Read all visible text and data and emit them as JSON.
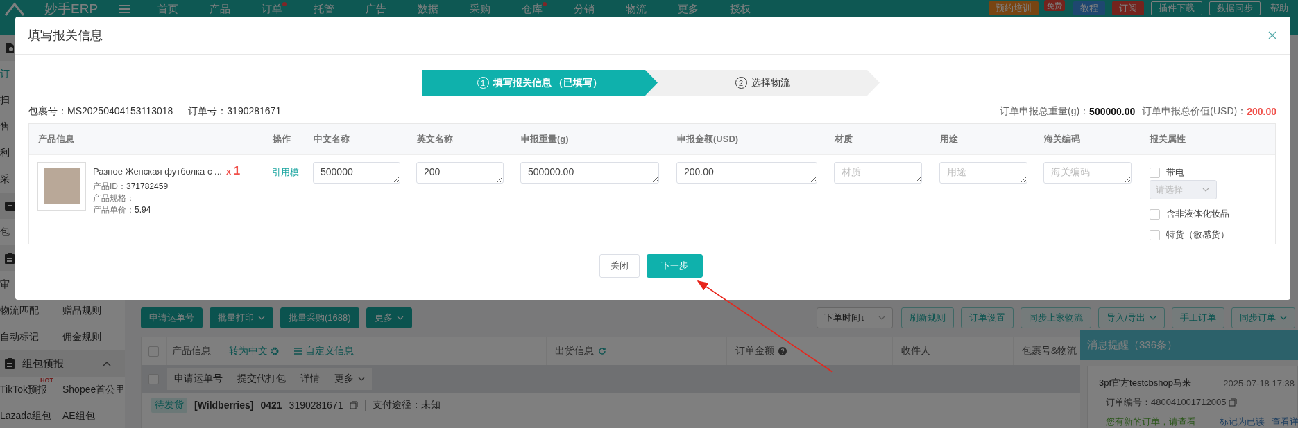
{
  "top_nav": {
    "logo": "妙手ERP",
    "items": [
      {
        "label": "首页",
        "dot": false
      },
      {
        "label": "产品",
        "dot": false
      },
      {
        "label": "订单",
        "dot": true
      },
      {
        "label": "托管",
        "dot": false
      },
      {
        "label": "广告",
        "dot": false
      },
      {
        "label": "数据",
        "dot": false
      },
      {
        "label": "采购",
        "dot": false
      },
      {
        "label": "仓库",
        "dot": true
      },
      {
        "label": "分销",
        "dot": false
      },
      {
        "label": "物流",
        "dot": false
      },
      {
        "label": "更多",
        "dot": false
      },
      {
        "label": "授权",
        "dot": false
      }
    ],
    "actions": [
      {
        "kind": "promo",
        "label": "预约培训",
        "badge": "免费"
      },
      {
        "kind": "info",
        "label": "教程"
      },
      {
        "kind": "danger",
        "label": "订阅"
      },
      {
        "kind": "outline",
        "label": "插件下载"
      },
      {
        "kind": "sync",
        "label": "数据同步"
      },
      {
        "kind": "help",
        "label": "帮助"
      }
    ]
  },
  "sidebar": {
    "sections": [
      {
        "kind": "gear-doc",
        "rows": [
          [
            {
              "label": "订",
              "selected": true
            }
          ],
          [
            {
              "label": "扫",
              "selected": false
            }
          ],
          [
            {
              "label": "售",
              "selected": false
            }
          ],
          [
            {
              "label": "利",
              "selected": false
            }
          ],
          [
            {
              "label": "采",
              "selected": false
            }
          ]
        ]
      },
      {
        "kind": "box",
        "rows": [
          [
            {
              "label": "包",
              "selected": false
            }
          ]
        ]
      },
      {
        "kind": "clipboard",
        "rows": [
          [
            {
              "label": "审",
              "selected": false
            }
          ],
          [
            {
              "label": "物流匹配",
              "selected": false
            },
            {
              "label": "赠品规则",
              "selected": false
            }
          ],
          [
            {
              "label": "自动标记",
              "selected": false
            },
            {
              "label": "佣金规则",
              "selected": false
            }
          ]
        ]
      },
      {
        "kind": "clipboard",
        "title": "组包预报",
        "expanded": true,
        "rows": [
          [
            {
              "label": "TikTok预报",
              "selected": false,
              "badge": "HOT"
            },
            {
              "label": "Shopee首公里",
              "selected": false
            }
          ],
          [
            {
              "label": "Lazada组包",
              "selected": false
            },
            {
              "label": "AE组包",
              "selected": false
            }
          ]
        ]
      }
    ]
  },
  "toolbar": {
    "left": [
      {
        "label": "申请运单号",
        "dropdown": false
      },
      {
        "label": "批量打印",
        "dropdown": true
      },
      {
        "label": "批量采购(1688)",
        "dropdown": false
      },
      {
        "label": "更多",
        "dropdown": true
      }
    ],
    "sort": {
      "value": "下单时间↓"
    },
    "right": [
      {
        "label": "刷新规则",
        "dropdown": false
      },
      {
        "label": "订单设置",
        "dropdown": false
      },
      {
        "label": "同步上家物流",
        "dropdown": false
      },
      {
        "label": "导入/导出",
        "dropdown": true
      },
      {
        "label": "手工订单",
        "dropdown": false
      },
      {
        "label": "同步订单",
        "dropdown": true
      }
    ]
  },
  "orders_table": {
    "product_header": {
      "label": "产品信息",
      "translate_link": "转为中文",
      "custom_link": "自定义信息"
    },
    "select_all_checked": false,
    "bulk_checked": false,
    "columns": [
      {
        "label": "出货信息",
        "kind": "refresh"
      },
      {
        "label": "订单金额",
        "kind": "help"
      },
      {
        "label": "收件人"
      },
      {
        "label": "包裹号&物流"
      }
    ],
    "bulk_actions": [
      {
        "label": "申请运单号",
        "dropdown": false
      },
      {
        "label": "提交代打包",
        "dropdown": false
      },
      {
        "label": "详情",
        "dropdown": false
      },
      {
        "label": "更多",
        "dropdown": true
      }
    ],
    "order": {
      "status": "待发货",
      "platform": "[Wildberries]",
      "code": "0421",
      "order_no": "3190281671",
      "payment": "支付途径：未知"
    }
  },
  "notification": {
    "title": "消息提醒（336条）",
    "messages": [
      {
        "shop": "3pf官方testcbshop马来",
        "time": "2025-07-18 17:38",
        "order_no": "订单编号：480041001712005",
        "text": "您有新的订单，请查看",
        "actions": [
          "标记为已读",
          "查看详"
        ]
      }
    ]
  },
  "modal": {
    "title": "填写报关信息",
    "steps": [
      {
        "number": "1",
        "label": "填写报关信息 （已填写）",
        "selected": true
      },
      {
        "number": "2",
        "label": "选择物流",
        "selected": false
      }
    ],
    "package_no": "包裹号：MS20250404153113018",
    "order_no": "订单号：3190281671",
    "total_weight": {
      "label": "订单申报总重量(g)：",
      "value": "500000.00"
    },
    "total_value": {
      "label": "订单申报总价值(USD)：",
      "value": "200.00"
    },
    "table": {
      "columns": [
        "产品信息",
        "操作",
        "中文名称",
        "英文名称",
        "申报重量(g)",
        "申报金额(USD)",
        "材质",
        "用途",
        "海关编码",
        "报关属性"
      ],
      "rows": [
        {
          "product": {
            "title": "Разное Женская футболка с ...",
            "quantity_prefix": "x",
            "quantity": "1",
            "details": [
              {
                "label": "产品ID：",
                "value": "371782459"
              },
              {
                "label": "产品规格："
              },
              {
                "label": "产品单价：",
                "value": "5.94"
              }
            ]
          },
          "action": "引用模",
          "fields": [
            {
              "value": "500000"
            },
            {
              "value": "200"
            },
            {
              "value": "500000.00"
            },
            {
              "value": "200.00"
            },
            {
              "placeholder": "材质"
            },
            {
              "placeholder": "用途"
            },
            {
              "placeholder": "海关编码"
            }
          ],
          "attributes": [
            {
              "label": "带电",
              "checked": false,
              "select": {
                "placeholder": "请选择",
                "disabled": true
              }
            },
            {
              "label": "含非液体化妆品",
              "checked": false
            },
            {
              "label": "特货（敏感货）",
              "checked": false
            }
          ]
        }
      ]
    },
    "buttons": [
      {
        "label": "关闭",
        "kind": "default"
      },
      {
        "label": "下一步",
        "kind": "primary"
      }
    ]
  }
}
